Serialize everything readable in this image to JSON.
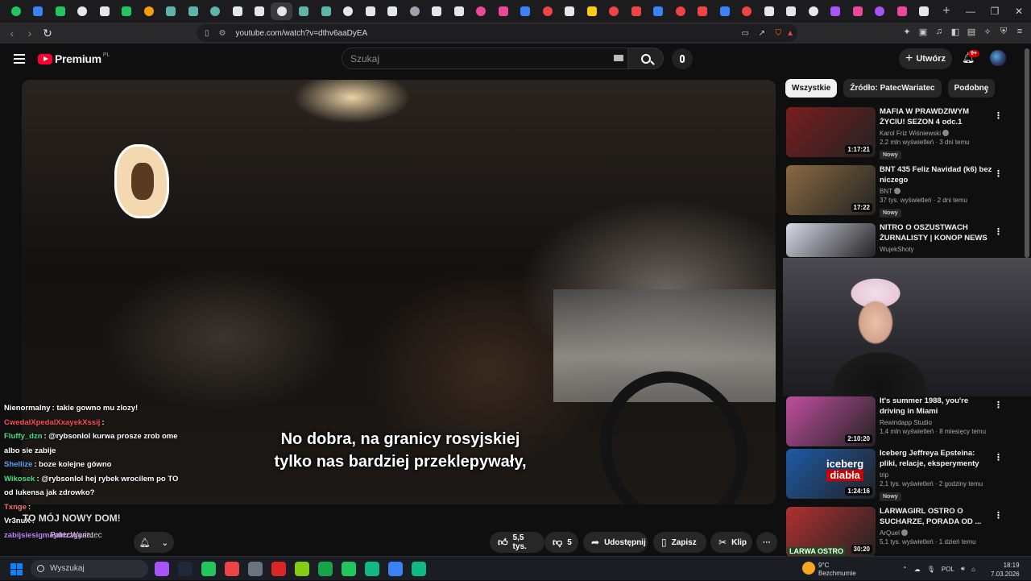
{
  "browser": {
    "tabs_count": 41,
    "active_tab_index": 12,
    "tab_colors": [
      "#22c55e",
      "#3b82f6",
      "#22c55e",
      "#e5e7eb",
      "#e5e7eb",
      "#22c55e",
      "#f59e0b",
      "#5eb4a8",
      "#5eb4a8",
      "#5eb4a8",
      "#e5e7eb",
      "#e5e7eb",
      "#e5e7eb",
      "#5eb4a8",
      "#5eb4a8",
      "#e5e7eb",
      "#e5e7eb",
      "#e5e7eb",
      "#9ca3af",
      "#e5e7eb",
      "#e5e7eb",
      "#ec4899",
      "#ec4899",
      "#3b82f6",
      "#ef4444",
      "#e5e7eb",
      "#facc15",
      "#ef4444",
      "#ef4444",
      "#3b82f6",
      "#ef4444",
      "#ef4444",
      "#3b82f6",
      "#ef4444",
      "#e5e7eb",
      "#e5e7eb",
      "#e5e7eb",
      "#a855f7",
      "#ec4899",
      "#a855f7",
      "#ec4899",
      "#e5e7eb"
    ],
    "url": "youtube.com/watch?v=dthv6aaDyEA"
  },
  "youtube": {
    "brand": "Premium",
    "region": "PL",
    "search_placeholder": "Szukaj",
    "create_label": "Utwórz",
    "notifications": "9+"
  },
  "player": {
    "subtitle_line1": "No dobra, na granicy rosyjskiej",
    "subtitle_line2": "tylko nas bardziej przeklepywały,"
  },
  "chat": {
    "messages": [
      {
        "user": "Nienormalny",
        "text": ": takie gowno mu zlozy!",
        "color": "#ffffff"
      },
      {
        "user": "CwedalXpedalXxayekXssij",
        "text": ":",
        "color": "#ff4d4d"
      },
      {
        "user": "Fluffy_dzn",
        "text": ": @rybsonlol kurwa prosze zrob ome albo sie zabije",
        "color": "#4ade80"
      },
      {
        "user": "Shellize",
        "text": ": boze kolejne gówno",
        "color": "#60a5fa"
      },
      {
        "user": "Wikosek",
        "text": ": @rybsonlol hej rybek wrocilem po TO od lukensa jak zdrowko?",
        "color": "#4ade80"
      },
      {
        "user": "Txnge",
        "text": ":",
        "color": "#f87171"
      },
      {
        "user": "Vr3nuX",
        "text": ":",
        "color": "#ffffff"
      },
      {
        "user": "zabijsiesigmaplrizzgyat",
        "text": ":",
        "color": "#c084fc"
      }
    ],
    "banner": "TO MÓJ NOWY DOM!",
    "streamer": "PatecWariatec"
  },
  "actions": {
    "likes": "5,5 tys.",
    "dislikes": "5",
    "share": "Udostępnij",
    "save": "Zapisz",
    "clip": "Klip",
    "more": "···"
  },
  "sidebar": {
    "chips": [
      {
        "label": "Wszystkie",
        "selected": true
      },
      {
        "label": "Źródło: PatecWariatec",
        "selected": false
      },
      {
        "label": "Podobne",
        "selected": false
      }
    ],
    "videos": [
      {
        "title": "MAFIA W PRAWDZIWYM ŻYCIU! SEZON 4 odc.1",
        "channel": "Karol Friz Wiśniewski",
        "stats": "2,2 mln wyświetleń · 3 dni temu",
        "duration": "1:17:21",
        "badge": "Nowy",
        "thumb_color": "#7a1e1e"
      },
      {
        "title": "BNT 435 Feliz Navidad (k6) bez niczego",
        "channel": "BNT",
        "stats": "37 tys. wyświetleń · 2 dni temu",
        "duration": "17:22",
        "badge": "Nowy",
        "thumb_color": "#8a6a40"
      },
      {
        "title": "NITRO O OSZUSTWACH ŻURNALISTY | KONOP NEWS",
        "channel": "WujekShoty",
        "stats": "",
        "duration": "",
        "badge": "",
        "thumb_color": "#d9d9e8"
      },
      {
        "title": "It's summer 1988, you're driving in Miami",
        "channel": "Rewindapp Studio",
        "stats": "1,4 mln wyświetleń · 8 miesięcy temu",
        "duration": "2:10:20",
        "badge": "",
        "thumb_color": "#c04fa0"
      },
      {
        "title": "Iceberg Jeffreya Epsteina: pliki, relacje, eksperymenty",
        "channel": "trip",
        "stats": "2,1 tys. wyświetleń · 2 godziny temu",
        "duration": "1:24:16",
        "badge": "Nowy",
        "thumb_color": "#1e5aa8"
      },
      {
        "title": "LARWAGIRL OSTRO O SUCHARZE, PORADA OD ...",
        "channel": "ArQuel",
        "stats": "5,1 tys. wyświetleń · 1 dzień temu",
        "duration": "30:20",
        "badge": "",
        "thumb_color": "#b03030"
      }
    ],
    "thumb_texts": {
      "iceberg_line1": "iceberg",
      "iceberg_line2": "diabła",
      "larwa": "LARWA OSTRO"
    }
  },
  "taskbar": {
    "search_label": "Wyszukaj",
    "weather_temp": "9°C",
    "weather_desc": "Bezchmurnie",
    "lang": "POL",
    "time": "18:19",
    "date": "7.03.2026",
    "icon_colors": [
      "#a855f7",
      "#1f2937",
      "#22c55e",
      "#ef4444",
      "#6b7280",
      "#dc2626",
      "#84cc16",
      "#16a34a",
      "#22c55e",
      "#10b981",
      "#3b82f6",
      "#10b981"
    ]
  }
}
